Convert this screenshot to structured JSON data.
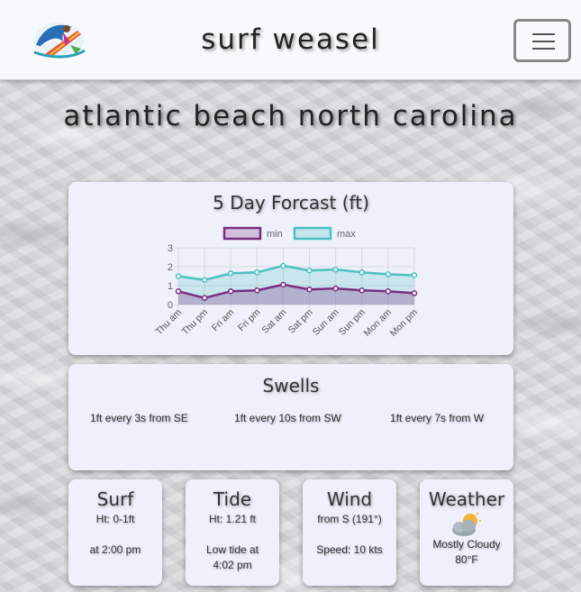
{
  "header": {
    "brand": "surf weasel"
  },
  "page_title": "Atlantic Beach North Carolina",
  "forecast": {
    "title": "5 Day Forcast (ft)"
  },
  "chart_data": {
    "type": "line",
    "title": "5 Day Forcast (ft)",
    "categories": [
      "Thu am",
      "Thu pm",
      "Fri am",
      "Fri pm",
      "Sat am",
      "Sat pm",
      "Sun am",
      "Sun pm",
      "Mon am",
      "Mon pm"
    ],
    "series": [
      {
        "name": "min",
        "values": [
          0.7,
          0.35,
          0.7,
          0.75,
          1.05,
          0.8,
          0.85,
          0.75,
          0.7,
          0.6
        ],
        "color": "#7b2d7f"
      },
      {
        "name": "max",
        "values": [
          1.5,
          1.3,
          1.65,
          1.7,
          2.05,
          1.8,
          1.85,
          1.7,
          1.6,
          1.55
        ],
        "color": "#4bc0c0"
      }
    ],
    "ylim": [
      0,
      3
    ],
    "yticks": [
      "0",
      "1",
      "2",
      "3"
    ],
    "legend": "top",
    "grid": true
  },
  "swells": {
    "title": "Swells",
    "items": [
      "1ft every 3s from SE",
      "1ft every 10s from SW",
      "1ft every 7s from W"
    ]
  },
  "surf": {
    "title": "Surf",
    "height": "Ht: 0-1ft",
    "time": "at 2:00 pm"
  },
  "tide": {
    "title": "Tide",
    "height": "Ht: 1.21 ft",
    "line1": "Low tide at",
    "line2": "4:02 pm"
  },
  "wind": {
    "title": "Wind",
    "direction": "from S (191°)",
    "speed": "Speed: 10 kts"
  },
  "weather": {
    "title": "Weather",
    "icon": "partly-cloudy-icon",
    "condition": "Mostly Cloudy",
    "temp": "80°F"
  },
  "colors": {
    "min_series": "#7b2d7f",
    "max_series": "#4bc0c0",
    "card_bg": "#eef0fb"
  }
}
